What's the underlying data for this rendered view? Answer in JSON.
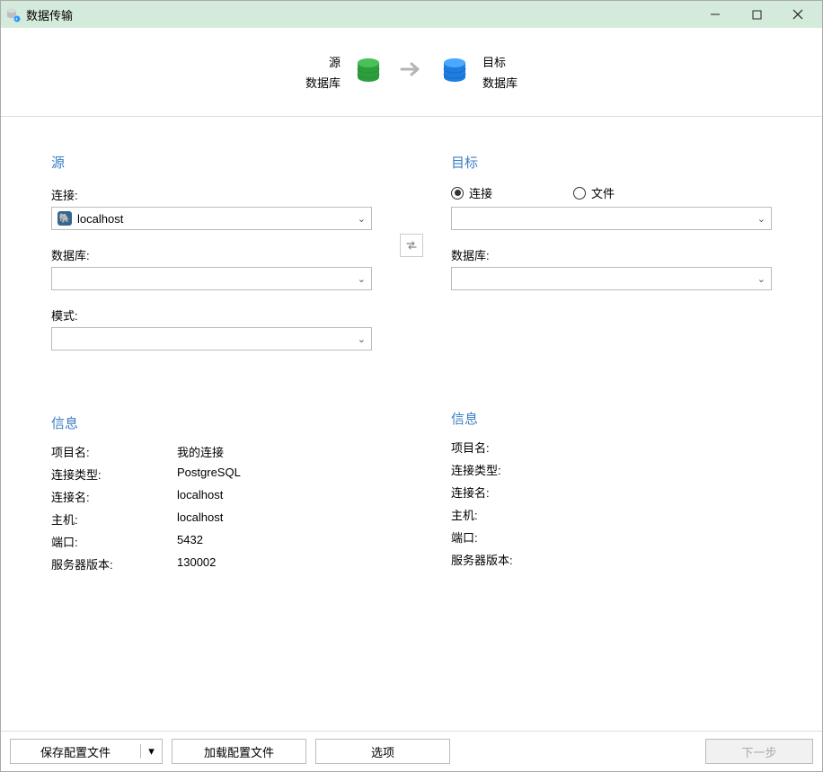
{
  "titlebar": {
    "title": "数据传输"
  },
  "banner": {
    "source_title": "源",
    "source_sub": "数据库",
    "target_title": "目标",
    "target_sub": "数据库"
  },
  "source": {
    "heading": "源",
    "conn_label": "连接:",
    "conn_value": "localhost",
    "db_label": "数据库:",
    "db_value": "",
    "schema_label": "模式:",
    "schema_value": ""
  },
  "target": {
    "heading": "目标",
    "radio_conn": "连接",
    "radio_file": "文件",
    "selected_radio": "conn",
    "conn_value": "",
    "db_label": "数据库:",
    "db_value": ""
  },
  "info_left": {
    "heading": "信息",
    "rows": [
      {
        "k": "项目名:",
        "v": "我的连接"
      },
      {
        "k": "连接类型:",
        "v": "PostgreSQL"
      },
      {
        "k": "连接名:",
        "v": "localhost"
      },
      {
        "k": "主机:",
        "v": "localhost"
      },
      {
        "k": "端口:",
        "v": "5432"
      },
      {
        "k": "服务器版本:",
        "v": "130002"
      }
    ]
  },
  "info_right": {
    "heading": "信息",
    "rows": [
      {
        "k": "项目名:",
        "v": ""
      },
      {
        "k": "连接类型:",
        "v": ""
      },
      {
        "k": "连接名:",
        "v": ""
      },
      {
        "k": "主机:",
        "v": ""
      },
      {
        "k": "端口:",
        "v": ""
      },
      {
        "k": "服务器版本:",
        "v": ""
      }
    ]
  },
  "footer": {
    "save_profile": "保存配置文件",
    "load_profile": "加载配置文件",
    "options": "选项",
    "next": "下一步"
  }
}
